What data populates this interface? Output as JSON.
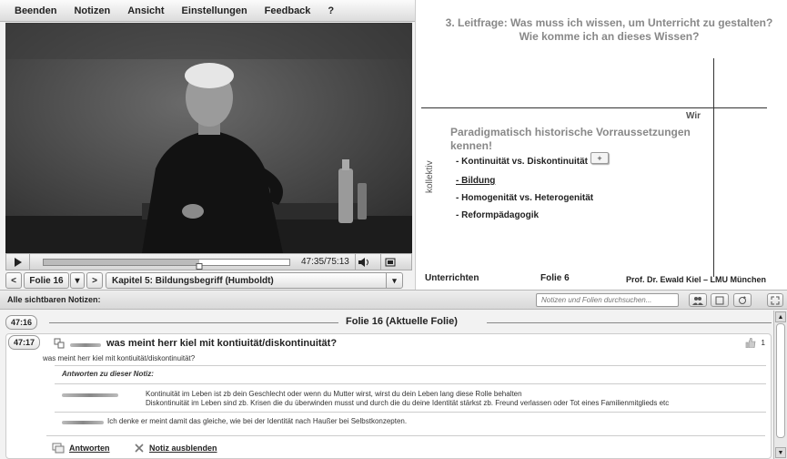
{
  "menu": [
    "Beenden",
    "Notizen",
    "Ansicht",
    "Einstellungen",
    "Feedback",
    "?"
  ],
  "player": {
    "time": "47:35/75:13",
    "progress": 0.633
  },
  "nav": {
    "prev": "<",
    "slide": "Folie 16",
    "dropdown_arrow": "▾",
    "next": ">",
    "chapter": "Kapitel 5:  Bildungsbegriff (Humboldt)"
  },
  "slide": {
    "title_line1": "3. Leitfrage: Was muss ich wissen, um Unterricht zu gestalten?",
    "title_line2": "Wie komme ich an dieses Wissen?",
    "wir": "Wir",
    "kollektiv": "kollektiv",
    "subtitle": "Paradigmatisch historische Vorraussetzungen kennen!",
    "bullets": [
      "- Kontinuität vs. Diskontinuität",
      "- Bildung",
      "- Homogenität vs. Heterogenität",
      "- Reformpädagogik"
    ],
    "plus": "+",
    "footer_left": "Unterrichten",
    "footer_center": "Folie 6",
    "footer_right": "Prof. Dr. Ewald Kiel – LMU München"
  },
  "notes": {
    "header": "Alle sichtbaren Notizen:",
    "search_placeholder": "Notizen und Folien durchsuchen...",
    "folie_time": "47:16",
    "folie_label": "Folie 16  (Aktuelle Folie)",
    "note": {
      "time": "47:17",
      "title": "was meint herr kiel mit kontiuität/diskontinuität?",
      "body": "was meint herr kiel mit kontiuität/diskontinuität?",
      "likes": "1",
      "answers_heading": "Antworten zu dieser Notiz:",
      "answer1_line1": "Kontinuität im Leben ist zb dein Geschlecht oder wenn du Mutter wirst, wirst du dein Leben lang diese Rolle behalten",
      "answer1_line2": "Diskontinuität im Leben sind zb. Krisen die du überwinden musst und durch die du deine Identität stärkst zb. Freund verlassen oder Tot eines Familienmitglieds etc",
      "answer2": "Ich denke er meint damit das gleiche, wie bei der Identität nach Haußer bei Selbstkonzepten.",
      "reply_label": "Antworten",
      "hide_label": "Notiz ausblenden"
    }
  }
}
